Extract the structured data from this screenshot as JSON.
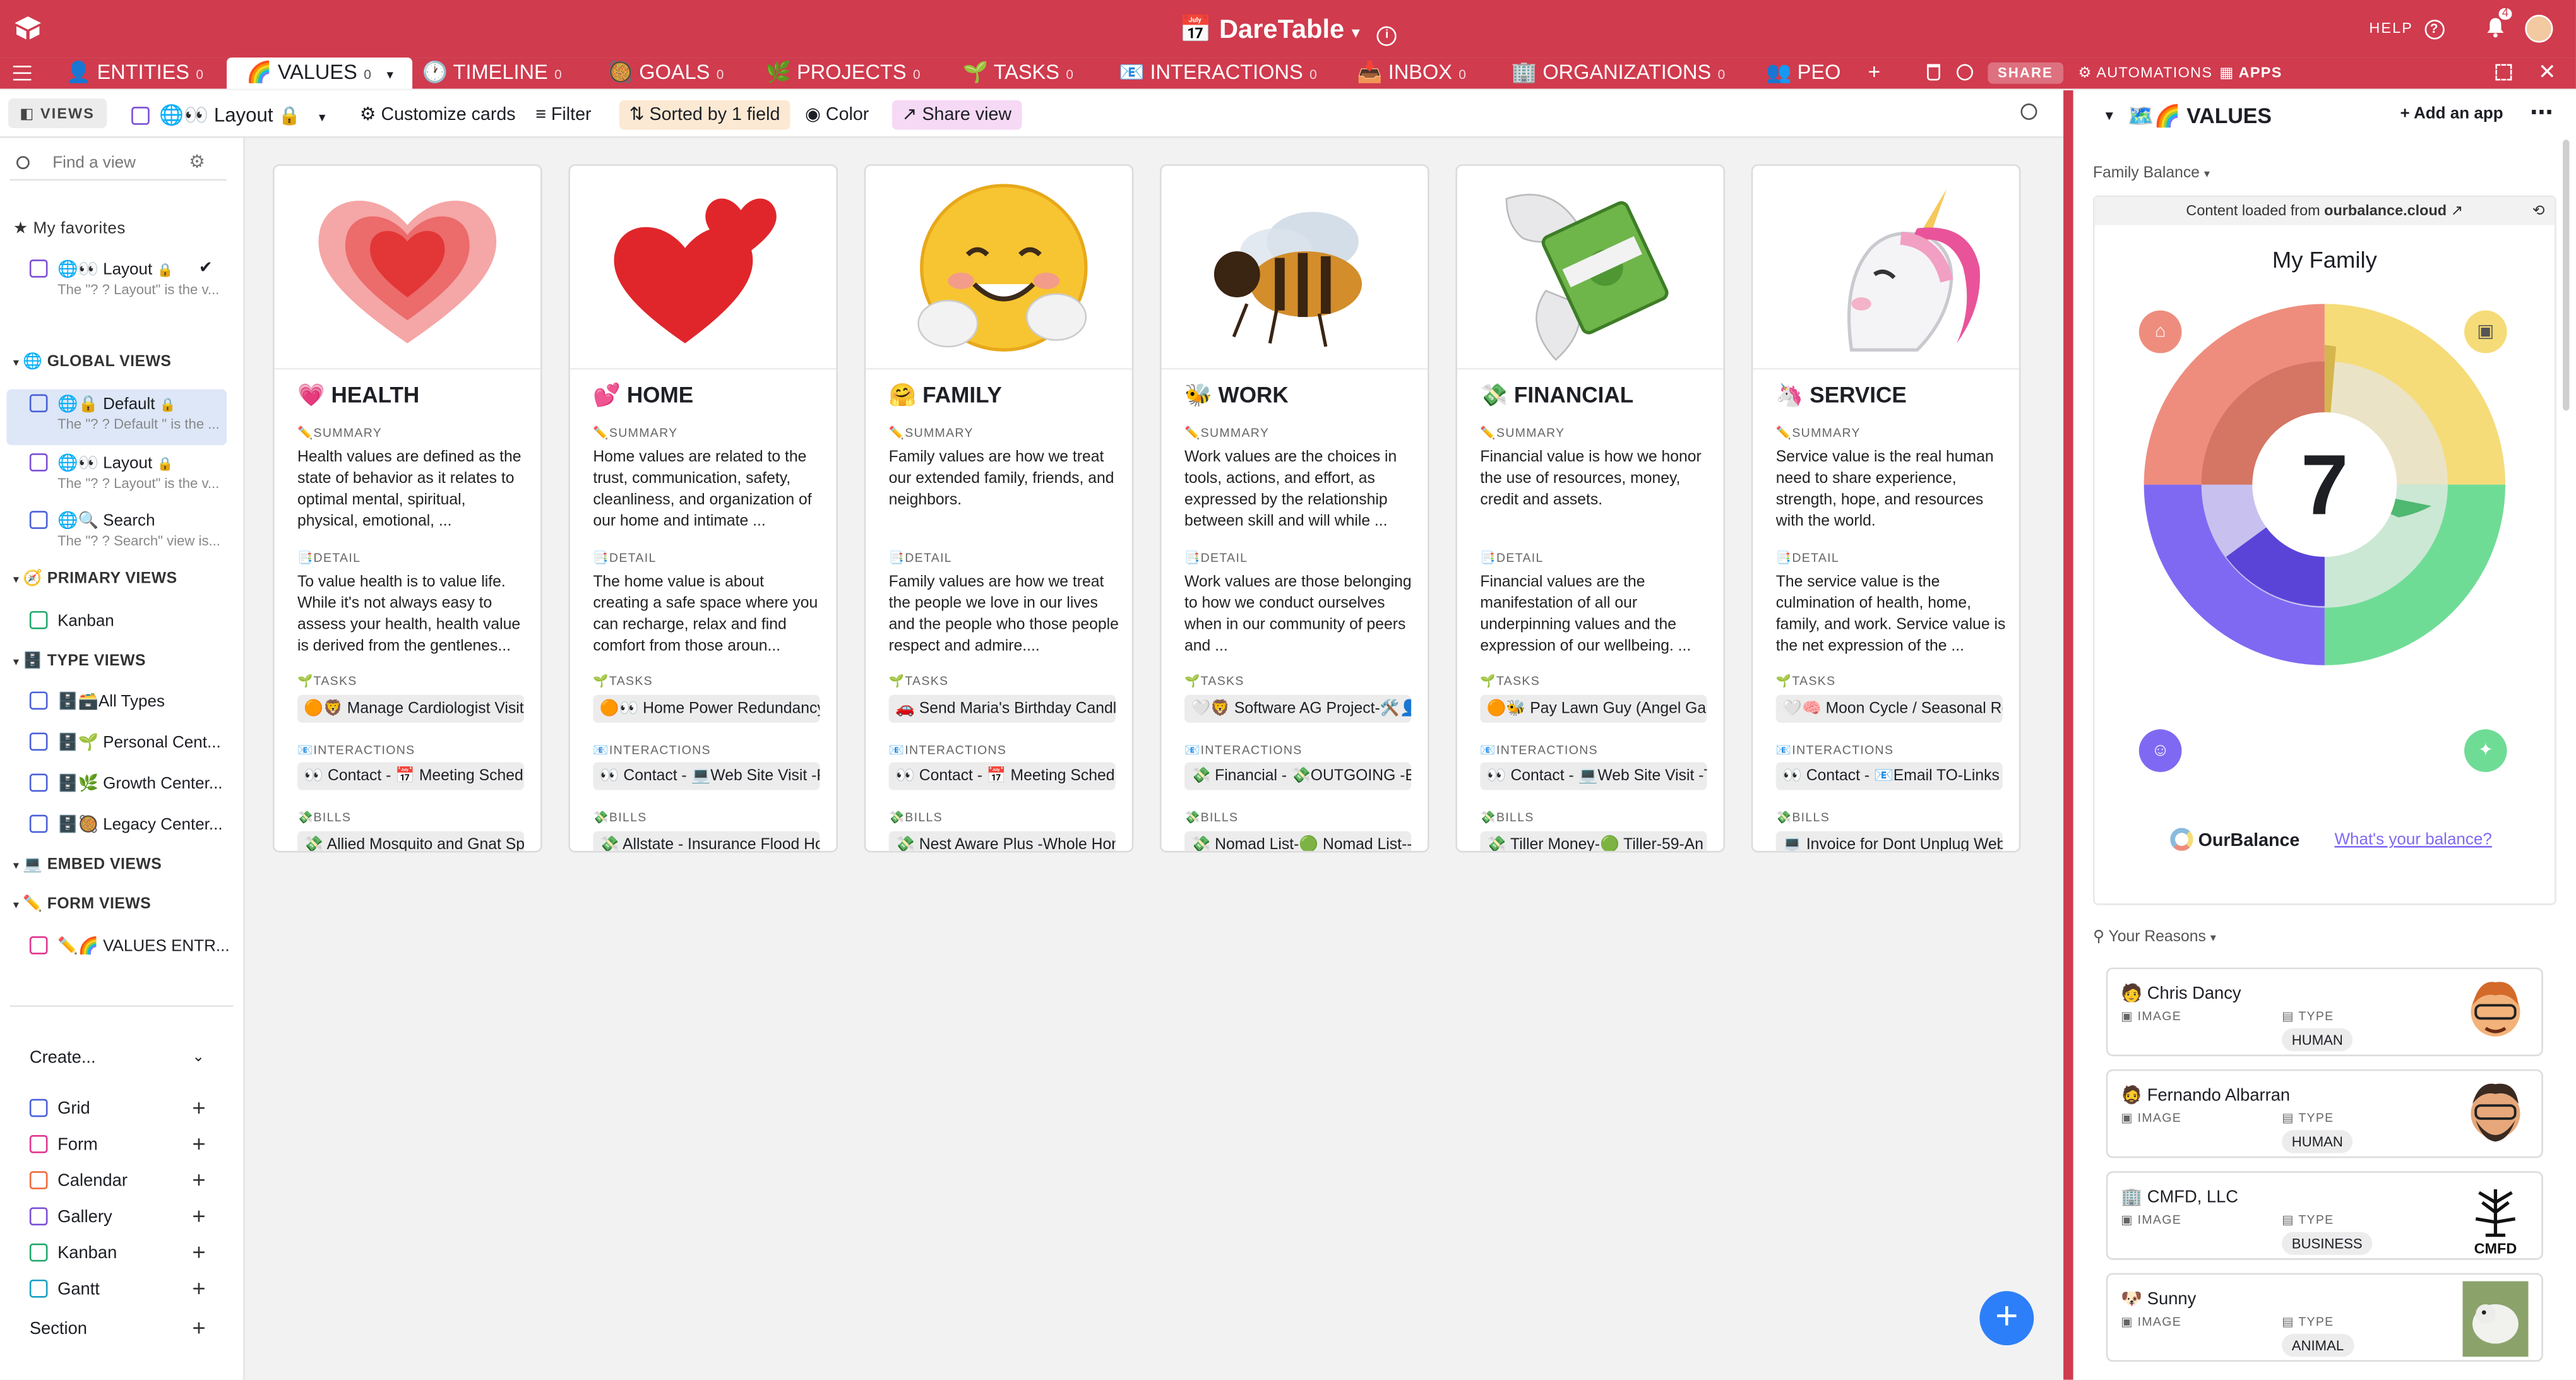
{
  "app": {
    "title": "📅 DareTable",
    "help_label": "HELP",
    "notif_count": "4"
  },
  "tabs": [
    {
      "label": "👤 ENTITIES",
      "num": "0"
    },
    {
      "label": "🌈 VALUES",
      "num": "0"
    },
    {
      "label": "🕐 TIMELINE",
      "num": "0"
    },
    {
      "label": "🥘 GOALS",
      "num": "0"
    },
    {
      "label": "🌿 PROJECTS",
      "num": "0"
    },
    {
      "label": "🌱 TASKS",
      "num": "0"
    },
    {
      "label": "📧 INTERACTIONS",
      "num": "0"
    },
    {
      "label": "📥 INBOX",
      "num": "0"
    },
    {
      "label": "🏢 ORGANIZATIONS",
      "num": "0"
    },
    {
      "label": "👥 PEO",
      "num": "0"
    }
  ],
  "tab_actions": {
    "share": "SHARE",
    "automations": "AUTOMATIONS",
    "apps": "APPS"
  },
  "viewbar": {
    "views": "VIEWS",
    "view_name": "🌐👀 Layout",
    "customize": "Customize cards",
    "filter": "Filter",
    "sorted": "Sorted by 1 field",
    "color": "Color",
    "share_view": "Share view"
  },
  "sidebar": {
    "find_placeholder": "Find a view",
    "favorites_title": "My favorites",
    "favorites": [
      {
        "label": "🌐👀 Layout",
        "sub": "The \"? ? Layout\" is the v..."
      }
    ],
    "global_title": "🌐 GLOBAL VIEWS",
    "global": [
      {
        "label": "🌐🔒 Default",
        "sub": "The \"? ? Default \" is the ..."
      },
      {
        "label": "🌐👀 Layout",
        "sub": "The \"? ? Layout\" is the v..."
      },
      {
        "label": "🌐🔍 Search",
        "sub": "The \"? ? Search\" view is..."
      }
    ],
    "primary_title": "🧭 PRIMARY VIEWS",
    "primary": [
      {
        "label": "Kanban"
      }
    ],
    "type_title": "🗄️ TYPE VIEWS",
    "type": [
      {
        "label": "🗄️🗃️All Types"
      },
      {
        "label": "🗄️🌱 Personal Cent..."
      },
      {
        "label": "🗄️🌿 Growth Center..."
      },
      {
        "label": "🗄️🥘 Legacy Center..."
      }
    ],
    "embed_title": "💻 EMBED VIEWS",
    "form_title": "✏️ FORM VIEWS",
    "form": [
      {
        "label": "✏️🌈 VALUES ENTR..."
      }
    ],
    "create_title": "Create...",
    "create": [
      "Grid",
      "Form",
      "Calendar",
      "Gallery",
      "Kanban",
      "Gantt",
      "Section"
    ]
  },
  "field_labels": {
    "summary": "✏️SUMMARY",
    "detail": "📑DETAIL",
    "tasks": "🌱TASKS",
    "interactions": "📧INTERACTIONS",
    "bills": "💸BILLS"
  },
  "cards": [
    {
      "title": "💗 HEALTH",
      "emoji": "heart-icon",
      "summary": "Health values are defined as the state of behavior as it relates to optimal mental, spiritual, physical, emotional, ...",
      "detail": "To value health is to value life. While it's not always easy to assess your health, health value is derived from the gentlenes...",
      "task": "🟠🦁 Manage Cardiologist Visit",
      "interaction": "👀 Contact - 📅 Meeting Schedu",
      "bill": "💸 Allied Mosquito and Gnat Sp"
    },
    {
      "title": "💕 HOME",
      "emoji": "two-hearts-icon",
      "summary": "Home values are related to the trust, communication, safety, cleanliness, and organization of our home and intimate ...",
      "detail": "The home value is about creating a safe space where you can recharge, relax and find comfort from those aroun...",
      "task": "🟠👀 Home Power Redundancy",
      "interaction": "👀 Contact - 💻Web Site Visit -F",
      "bill": "💸 Allstate - Insurance Flood Ho"
    },
    {
      "title": "🤗 FAMILY",
      "emoji": "hugging-face-icon",
      "summary": "Family values are how we treat our extended family, friends, and neighbors.",
      "detail": "Family values are how we treat the people we love in our lives and the people who those people respect and admire....",
      "task": "🚗 Send Maria's Birthday Candl",
      "interaction": "👀 Contact - 📅 Meeting Schedu",
      "bill": "💸 Nest Aware Plus -Whole Hon"
    },
    {
      "title": "🐝 WORK",
      "emoji": "bee-icon",
      "summary": "Work values are the choices in tools, actions, and effort, as expressed by the relationship between skill and will while ...",
      "detail": "Work values are those belonging to how we conduct ourselves when in our community of peers and ...",
      "task": "🤍🦁 Software AG Project-🛠️👤",
      "interaction": "💸 Financial - 💸OUTGOING -Bi",
      "bill": "💸 Nomad List-🟢 Nomad List--"
    },
    {
      "title": "💸 FINANCIAL",
      "emoji": "money-with-wings-icon",
      "summary": "Financial value is how we honor the use of resources, money, credit and assets.",
      "detail": "Financial values are the manifestation of all our underpinning values and the expression of our wellbeing. ...",
      "task": "🟠🐝 Pay Lawn Guy (Angel Gan",
      "interaction": "👀 Contact - 💻Web Site Visit -T",
      "bill": "💸 Tiller Money-🟢 Tiller-59-An"
    },
    {
      "title": "🦄 SERVICE",
      "emoji": "unicorn-icon",
      "summary": "Service value is the real human need to share experience, strength, hope, and resources with the world.",
      "detail": "The service value is the culmination of health, home, family, and work. Service value is the net expression of the ...",
      "task": "🤍🧠 Moon Cycle / Seasonal Re",
      "interaction": "👀 Contact - 📧Email TO-Links t",
      "bill": "💻 Invoice for Dont Unplug Web"
    }
  ],
  "panel": {
    "title": "🗺️🌈 VALUES",
    "add_app": "Add an app",
    "balance_title": "Family Balance",
    "content_loaded": "Content loaded from",
    "content_domain": "ourbalance.cloud",
    "chart_title": "My Family",
    "score": "7",
    "brand": "OurBalance",
    "balance_link": "What's your balance?",
    "reasons_title": "Your Reasons",
    "reasons": [
      {
        "name": "🧑 Chris Dancy",
        "type": "HUMAN"
      },
      {
        "name": "🧔 Fernando Albarran",
        "type": "HUMAN"
      },
      {
        "name": "🏢 CMFD, LLC",
        "type": "BUSINESS"
      },
      {
        "name": "🐶 Sunny",
        "type": "ANIMAL"
      }
    ],
    "image_label": "IMAGE",
    "type_label": "TYPE",
    "cmfd_logo": "CMFD"
  },
  "colors": {
    "brand": "#d03b4e",
    "accent": "#2d7ff9"
  }
}
